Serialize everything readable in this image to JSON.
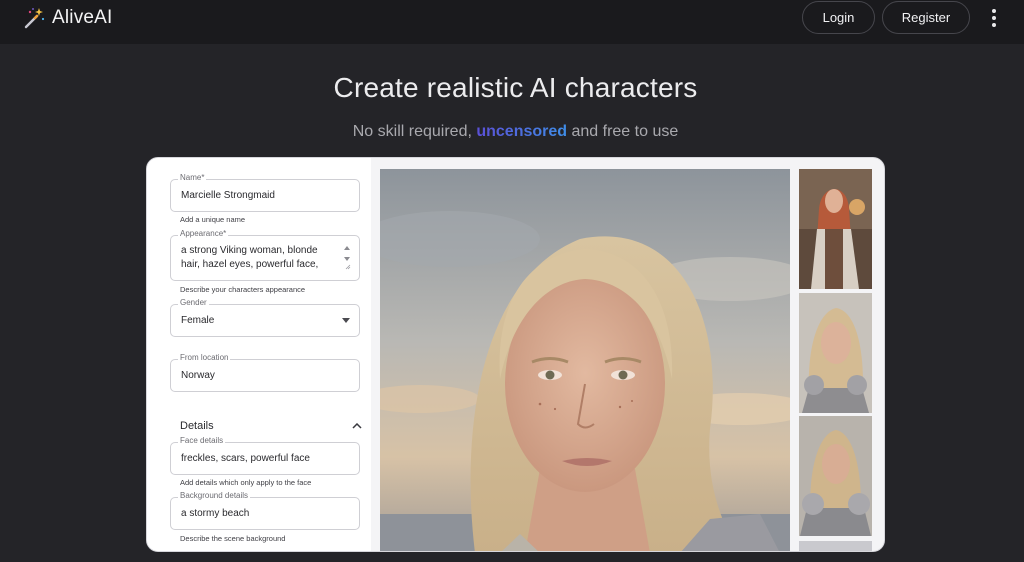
{
  "header": {
    "brand_name": "AliveAI",
    "login_label": "Login",
    "register_label": "Register"
  },
  "hero": {
    "title": "Create realistic AI characters",
    "subtitle_before": "No skill required, ",
    "subtitle_accent": "uncensored",
    "subtitle_after": " and free to use"
  },
  "form": {
    "name": {
      "label": "Name*",
      "value": "Marcielle Strongmaid",
      "helper": "Add a unique name"
    },
    "appearance": {
      "label": "Appearance*",
      "value": "a strong Viking woman, blonde hair, hazel eyes, powerful face,",
      "helper": "Describe your characters appearance"
    },
    "gender": {
      "label": "Gender",
      "value": "Female"
    },
    "location": {
      "label": "From location",
      "value": "Norway"
    },
    "details": {
      "title": "Details"
    },
    "face": {
      "label": "Face details",
      "value": "freckles, scars, powerful face",
      "helper": "Add details which only apply to the face"
    },
    "background": {
      "label": "Background details",
      "value": "a stormy beach",
      "helper": "Describe the scene background"
    }
  },
  "colors": {
    "page_bg": "#242428",
    "topbar_bg": "#1a1a1d",
    "accent_start": "#5b4fd6",
    "accent_end": "#3f8ee8"
  },
  "icons": [
    "magic-wand-icon",
    "more-vertical-icon",
    "dropdown-caret-icon",
    "chevron-up-icon",
    "resize-arrows-icon"
  ]
}
